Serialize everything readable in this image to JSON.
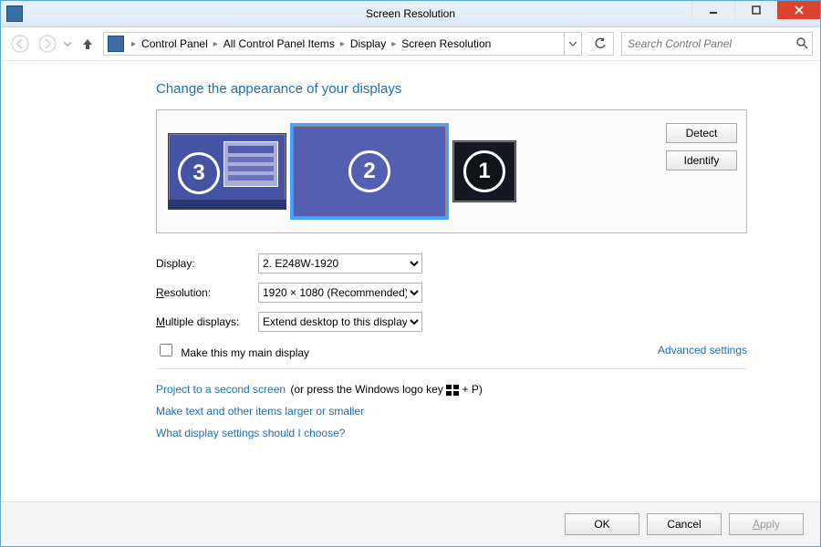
{
  "title": "Screen Resolution",
  "breadcrumb": [
    "Control Panel",
    "All Control Panel Items",
    "Display",
    "Screen Resolution"
  ],
  "search_placeholder": "Search Control Panel",
  "heading": "Change the appearance of your displays",
  "monitors": {
    "m3": "3",
    "m2": "2",
    "m1": "1"
  },
  "btn_detect_pre": "De",
  "btn_detect_uk": "t",
  "btn_detect_post": "ect",
  "btn_identify_pre": "",
  "btn_identify_uk": "I",
  "btn_identify_post": "dentify",
  "label_display": "Display:",
  "label_resolution_pre": "",
  "label_resolution_uk": "R",
  "label_resolution_post": "esolution:",
  "label_multiple_pre": "",
  "label_multiple_uk": "M",
  "label_multiple_post": "ultiple displays:",
  "val_display": "2. E248W-1920",
  "val_resolution": "1920 × 1080 (Recommended)",
  "val_multiple": "Extend desktop to this display",
  "chk_main": "Make this my main display",
  "adv_link": "Advanced settings",
  "project_link": "Project to a second screen",
  "project_tail": " (or press the Windows logo key ",
  "project_plus_p": " + P)",
  "text_larger": "Make text and other items larger or smaller",
  "which_settings": "What display settings should I choose?",
  "btn_ok": "OK",
  "btn_cancel": "Cancel",
  "btn_apply_pre": "",
  "btn_apply_uk": "A",
  "btn_apply_post": "pply"
}
